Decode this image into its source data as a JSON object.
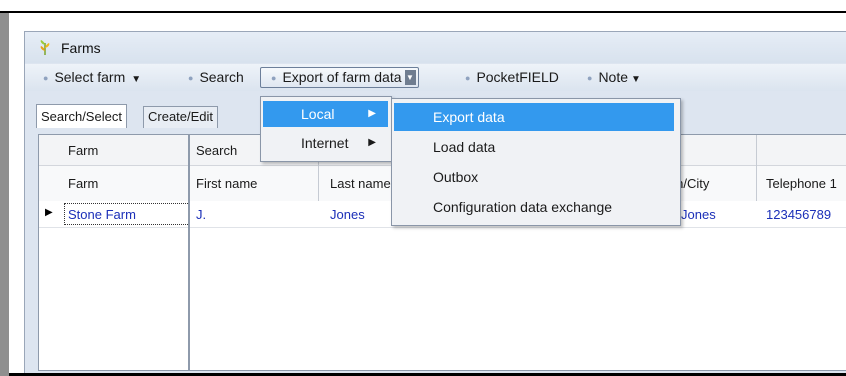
{
  "window": {
    "title": "Farms",
    "app_icon": "wheat-icon"
  },
  "toolbar": {
    "select_farm": "Select farm",
    "search": "Search",
    "export": "Export of farm data",
    "pocketfield": "PocketFIELD",
    "note": "Note"
  },
  "tabs": [
    "Search/Select",
    "Create/Edit"
  ],
  "table": {
    "filter_headers": [
      "Farm",
      "Search"
    ],
    "columns": [
      "Farm",
      "First name",
      "Last name",
      "Town/City",
      "Telephone 1"
    ],
    "rows": [
      {
        "farm": "Stone Farm",
        "first_name": "J.",
        "last_name": "Jones",
        "town_city": "Jones",
        "telephone": "123456789"
      }
    ]
  },
  "menu_export": {
    "items": [
      {
        "label": "Local",
        "highlighted": true
      },
      {
        "label": "Internet",
        "highlighted": false
      }
    ]
  },
  "menu_local": {
    "items": [
      {
        "label": "Export data",
        "highlighted": true
      },
      {
        "label": "Load data",
        "highlighted": false
      },
      {
        "label": "Outbox",
        "highlighted": false
      },
      {
        "label": "Configuration data exchange",
        "highlighted": false
      }
    ]
  },
  "colors": {
    "highlight": "#3399ee",
    "link_text": "#1b2fb8",
    "window_bg": "#dde5f0"
  }
}
